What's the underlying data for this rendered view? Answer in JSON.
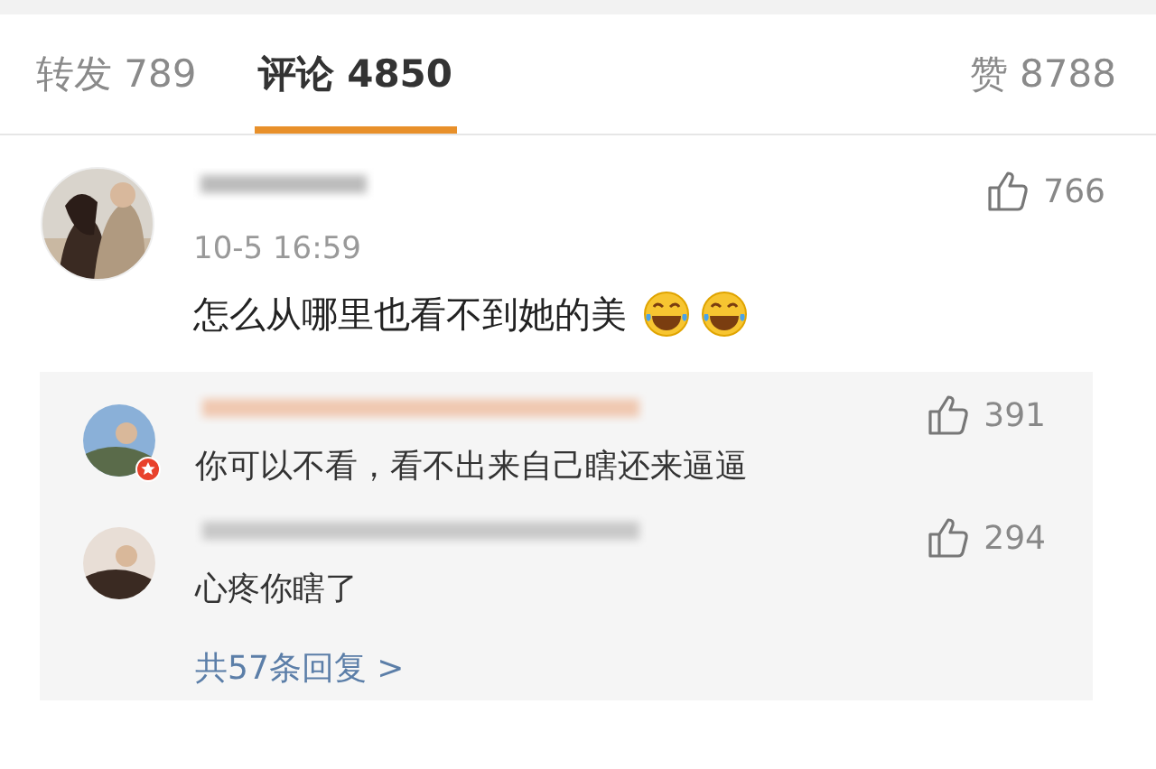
{
  "tabs": [
    {
      "label": "转发 789",
      "selected": false
    },
    {
      "label": "评论 4850",
      "selected": true
    },
    {
      "label": "赞 8788",
      "selected": false
    }
  ],
  "comment": {
    "time": "10-5 16:59",
    "text": "怎么从哪里也看不到她的美",
    "emojis": [
      {
        "kind": "laughing"
      },
      {
        "kind": "laughing"
      }
    ],
    "likes": "766"
  },
  "replies": [
    {
      "text": "你可以不看，看不出来自己瞎还来逼逼",
      "likes": "391",
      "badge": true
    },
    {
      "text": "心疼你瞎了",
      "likes": "294",
      "badge": false
    }
  ],
  "more_replies": "共57条回复 >"
}
